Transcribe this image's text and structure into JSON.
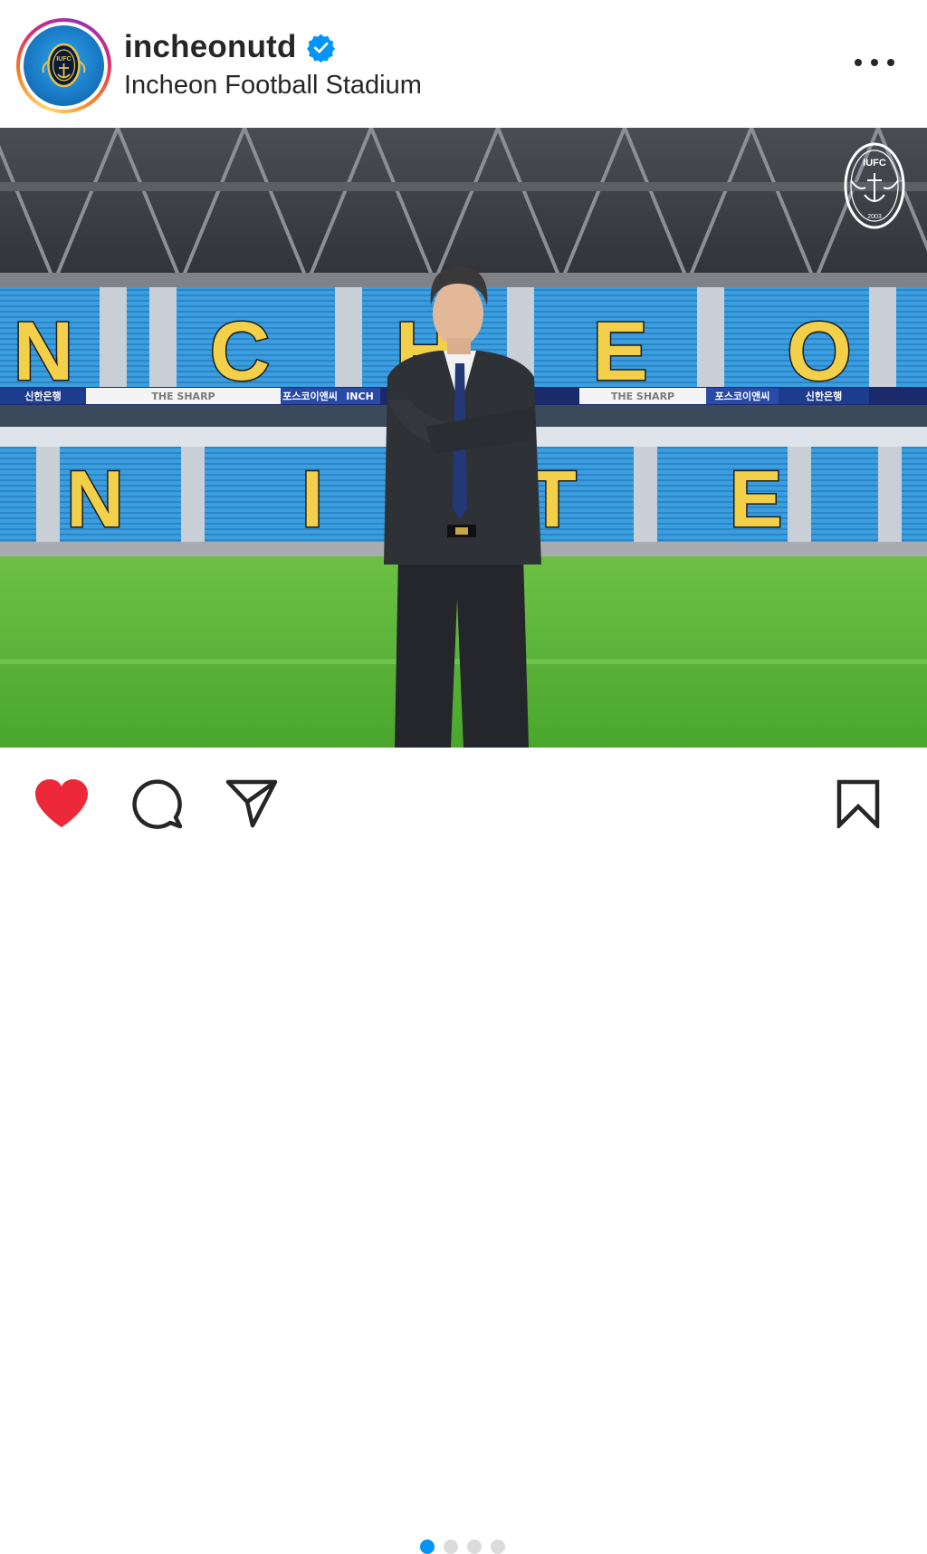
{
  "post": {
    "username": "incheonutd",
    "verified_icon": "verified-badge-icon",
    "location": "Incheon Football Stadium",
    "more_icon": "more-options-icon"
  },
  "photo": {
    "stand_letters_upper": [
      "N",
      "C",
      "H",
      "E",
      "O"
    ],
    "stand_letters_lower": [
      "N",
      "I",
      "T",
      "E"
    ],
    "sponsor_boards": [
      "신한은행",
      "THE SHARP",
      "포스코이앤씨",
      "INCH",
      "THE SHARP",
      "포스코이앤씨",
      "신한은행"
    ],
    "crest_text": "IUFC",
    "crest_year": "2003"
  },
  "actions": {
    "like_icon": "heart-filled-icon",
    "comment_icon": "comment-icon",
    "share_icon": "share-icon",
    "save_icon": "bookmark-icon",
    "carousel_total": 4,
    "carousel_active": 1
  },
  "colors": {
    "like": "#ed2939",
    "carousel_active": "#0095f6",
    "carousel_inactive": "#dbdbdb",
    "verified": "#0095f6",
    "seats_blue": "#3a9ee0",
    "letters_yellow": "#f2d04a",
    "pitch_green": "#5bb53a"
  }
}
